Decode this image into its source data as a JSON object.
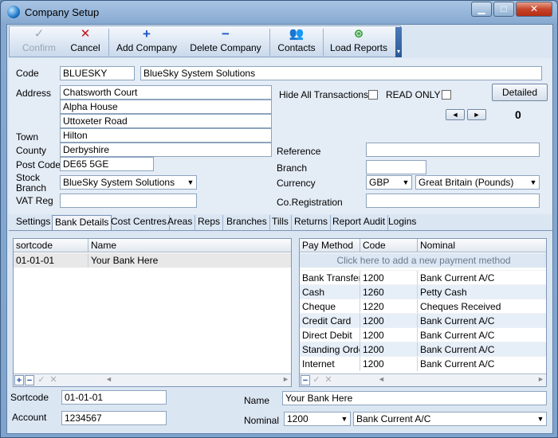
{
  "window": {
    "title": "Company Setup",
    "min": "▁",
    "max": "□",
    "close": "✕"
  },
  "toolbar": {
    "confirm": "Confirm",
    "cancel": "Cancel",
    "add_company": "Add Company",
    "delete_company": "Delete Company",
    "contacts": "Contacts",
    "load_reports": "Load Reports",
    "more": "▾"
  },
  "form": {
    "code_label": "Code",
    "code": "BLUESKY",
    "name": "BlueSky System Solutions",
    "address_label": "Address",
    "address1": "Chatsworth Court",
    "address2": "Alpha House",
    "address3": "Uttoxeter Road",
    "town_label": "Town",
    "town": "Hilton",
    "county_label": "County",
    "county": "Derbyshire",
    "postcode_label": "Post Code",
    "postcode": "DE65 5GE",
    "stock_branch_label1": "Stock",
    "stock_branch_label2": "Branch",
    "stock_branch": "BlueSky System Solutions",
    "vat_label": "VAT Reg",
    "vat": "",
    "hide_all_label": "Hide All Transactions",
    "read_only_label": "READ ONLY",
    "detailed_button": "Detailed",
    "prev": "◄",
    "next": "►",
    "counter": "0",
    "reference_label": "Reference",
    "reference": "",
    "branch_label": "Branch",
    "branch": "",
    "currency_label": "Currency",
    "currency_code": "GBP",
    "currency_name": "Great Britain (Pounds)",
    "coreg_label": "Co.Registration",
    "coreg": ""
  },
  "tabs": [
    "Settings",
    "Bank Details",
    "Cost Centres",
    "Areas",
    "Reps",
    "Branches",
    "Tills",
    "Returns",
    "Report Audit",
    "Logins"
  ],
  "bank_grid": {
    "headers": [
      "sortcode",
      "Name"
    ],
    "rows": [
      [
        "01-01-01",
        "Your Bank Here"
      ]
    ]
  },
  "pay_grid": {
    "headers": [
      "Pay Method",
      "Code",
      "Nominal"
    ],
    "add_prompt": "Click here to add a new payment method",
    "rows": [
      [
        "Bank Transfer",
        "1200",
        "Bank Current A/C"
      ],
      [
        "Cash",
        "1260",
        "Petty Cash"
      ],
      [
        "Cheque",
        "1220",
        "Cheques Received"
      ],
      [
        "Credit Card",
        "1200",
        "Bank Current A/C"
      ],
      [
        "Direct Debit",
        "1200",
        "Bank Current A/C"
      ],
      [
        "Standing Order",
        "1200",
        "Bank Current A/C"
      ],
      [
        "Internet",
        "1200",
        "Bank Current A/C"
      ]
    ]
  },
  "bottom": {
    "sortcode_label": "Sortcode",
    "sortcode": "01-01-01",
    "account_label": "Account",
    "account": "1234567",
    "name_label": "Name",
    "name": "Your Bank Here",
    "nominal_label": "Nominal",
    "nominal_code": "1200",
    "nominal_name": "Bank Current A/C"
  },
  "nav": {
    "add": "+",
    "remove": "−",
    "ok": "✓",
    "cancel": "✕",
    "left": "◄",
    "right": "►"
  }
}
